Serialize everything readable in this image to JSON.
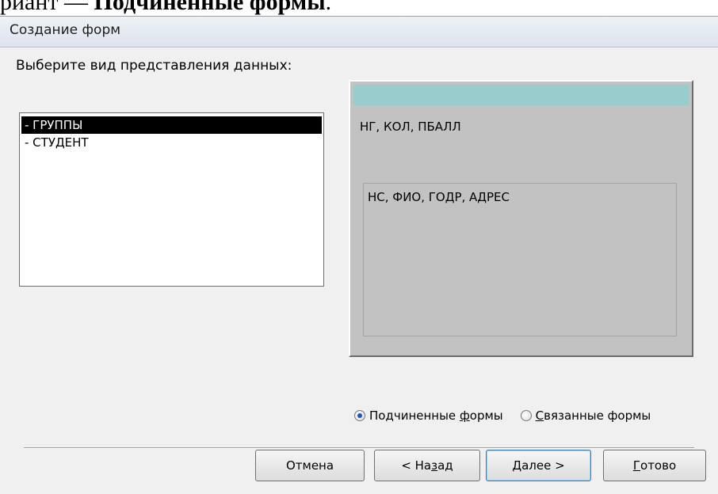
{
  "caption": {
    "prefix": "риант — ",
    "bold": "Подчиненные формы",
    "suffix": "."
  },
  "window": {
    "title": "Создание форм"
  },
  "prompt": {
    "label": "Выберите вид представления данных:"
  },
  "list": {
    "items": [
      {
        "label": "- ГРУППЫ",
        "selected": true
      },
      {
        "label": "- СТУДЕНТ",
        "selected": false
      }
    ]
  },
  "preview": {
    "main_fields": "НГ, КОЛ, ПБАЛЛ",
    "subform_fields": "НС, ФИО, ГОДР, АДРЕС",
    "bar_color": "#99cccc"
  },
  "options": {
    "subforms": {
      "pre": "Подчиненные ",
      "key": "ф",
      "post": "ормы",
      "checked": true
    },
    "linked": {
      "pre": "",
      "key": "С",
      "post": "вязанные формы",
      "checked": false
    }
  },
  "buttons": {
    "cancel": {
      "pre": "Отмена",
      "key": "",
      "post": ""
    },
    "back": {
      "pre": "< На",
      "key": "з",
      "post": "ад"
    },
    "next": {
      "pre": "",
      "key": "Д",
      "post": "алее >"
    },
    "finish": {
      "pre": "",
      "key": "Г",
      "post": "отово"
    }
  }
}
